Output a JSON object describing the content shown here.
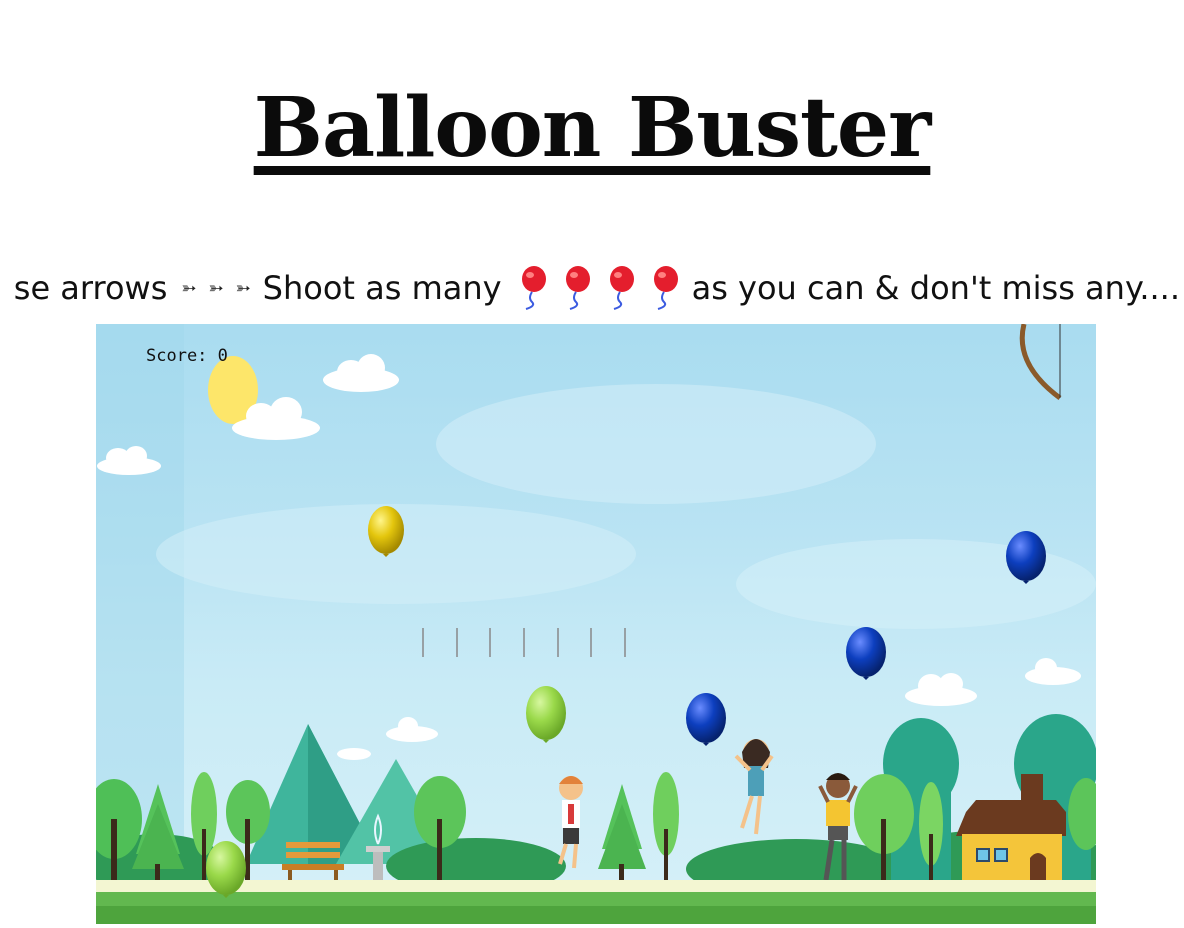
{
  "page": {
    "title": "Balloon Buster"
  },
  "marquee": {
    "text_start": "se arrows",
    "text_shoot": "Shoot as many",
    "text_end": "as you can & don't miss any....",
    "arrow_icon": "arrow-icon",
    "balloon_icon": "red-balloon-icon"
  },
  "game": {
    "score_label": "Score: 0",
    "arrows_remaining": 7,
    "balloon_colors": {
      "yellow": "#e4c60d",
      "green": "#9ad94a",
      "blue": "#0d3fbf"
    },
    "balloons_on_screen": [
      "yellow",
      "green",
      "green",
      "blue",
      "blue",
      "blue"
    ]
  }
}
